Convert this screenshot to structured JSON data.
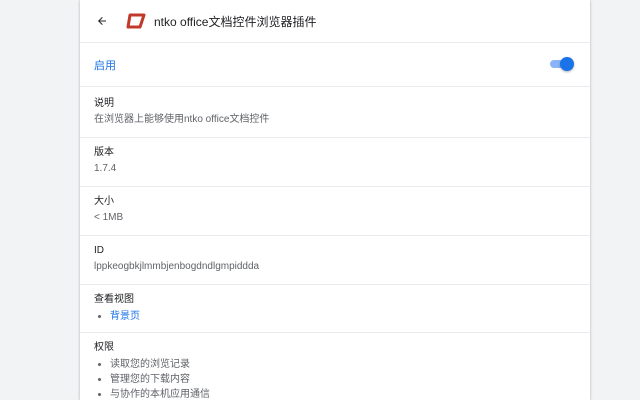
{
  "header": {
    "title": "ntko office文档控件浏览器插件",
    "back_icon": "arrow-back-icon",
    "logo_icon": "ntko-logo-icon",
    "logo_color": "#c0392b"
  },
  "enable": {
    "label": "启用",
    "enabled": true,
    "accent_color": "#1a73e8"
  },
  "details": {
    "description_label": "说明",
    "description_value": "在浏览器上能够使用ntko office文档控件",
    "version_label": "版本",
    "version_value": "1.7.4",
    "size_label": "大小",
    "size_value": "< 1MB",
    "id_label": "ID",
    "id_value": "lppkeogbkjlmmbjenbogdndlgmpiddda",
    "views_label": "查看视图",
    "views": [
      {
        "label": "背景页"
      }
    ],
    "permissions_label": "权限",
    "permissions": [
      {
        "label": "读取您的浏览记录"
      },
      {
        "label": "管理您的下载内容"
      },
      {
        "label": "与协作的本机应用通信"
      }
    ]
  }
}
